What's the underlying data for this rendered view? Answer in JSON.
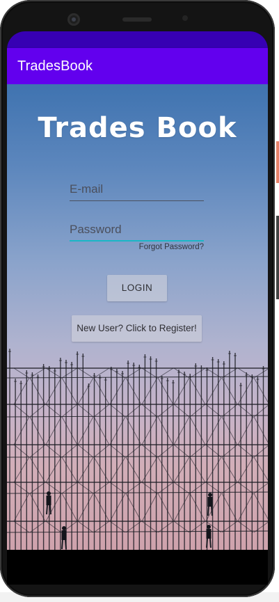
{
  "app": {
    "toolbar_title": "TradesBook"
  },
  "login": {
    "heading": "Trades Book",
    "email_placeholder": "E-mail",
    "password_placeholder": "Password",
    "forgot_password": "Forgot Password?",
    "login_button": "LOGIN",
    "register_button": "New User? Click to Register!"
  },
  "colors": {
    "status_bar": "#3700b3",
    "app_bar": "#6200ee",
    "input_focus_accent": "#1ab7c6"
  },
  "icons": [
    "camera-icon",
    "speaker-icon"
  ]
}
